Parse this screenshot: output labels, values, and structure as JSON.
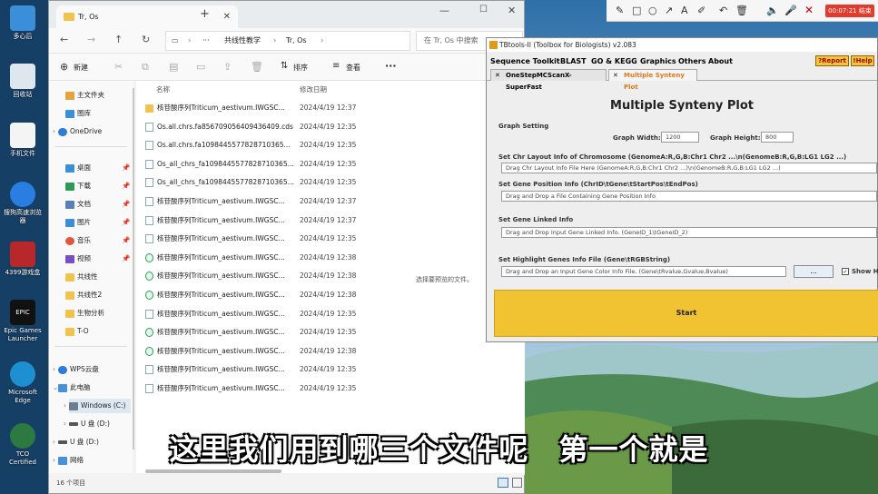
{
  "desktop": {
    "icons": [
      "多心后",
      "回收站",
      "手机文件",
      "搜狗高速浏览器",
      "4399游戏盒",
      "Epic Games Launcher",
      "Microsoft Edge",
      "TCO Certified"
    ]
  },
  "explorer": {
    "tab_title": "Tr, Os",
    "breadcrumb": [
      "共线性教学",
      "Tr, Os"
    ],
    "search_placeholder": "在 Tr, Os 中搜索",
    "toolbar": {
      "new": "新建",
      "sort": "排序",
      "view": "查看",
      "more": "···"
    },
    "sidebar": [
      "主文件夹",
      "图库",
      "OneDrive",
      "桌面",
      "下载",
      "文档",
      "图片",
      "音乐",
      "视频",
      "共线性",
      "共线性2",
      "生物分析",
      "T-O",
      "WPS云盘",
      "此电脑",
      "Windows (C:)",
      "U 盘 (D:)",
      "U 盘 (D:)",
      "网络"
    ],
    "columns": {
      "name": "名称",
      "date": "修改日期"
    },
    "files": [
      {
        "name": "核苷酸序列Triticum_aestivum.IWGSC...",
        "date": "2024/4/19 12:37",
        "kind": "folder"
      },
      {
        "name": "Os.all.chrs.fa85670905640943​6409.cds",
        "date": "2024/4/19 12:35",
        "kind": "file"
      },
      {
        "name": "Os.all.chrs.fa109844557782871​0365...",
        "date": "2024/4/19 12:35",
        "kind": "file"
      },
      {
        "name": "Os_all_chrs_fa109844557782871​0365...",
        "date": "2024/4/19 12:35",
        "kind": "file"
      },
      {
        "name": "Os_all_chrs_fa109844557782871​0365...",
        "date": "2024/4/19 12:35",
        "kind": "file"
      },
      {
        "name": "核苷酸序列Triticum_aestivum.IWGSC...",
        "date": "2024/4/19 12:37",
        "kind": "file"
      },
      {
        "name": "核苷酸序列Triticum_aestivum.IWGSC...",
        "date": "2024/4/19 12:37",
        "kind": "file"
      },
      {
        "name": "核苷酸序列Triticum_aestivum.IWGSC...",
        "date": "2024/4/19 12:35",
        "kind": "file"
      },
      {
        "name": "核苷酸序列Triticum_aestivum.IWGSC...",
        "date": "2024/4/19 12:38",
        "kind": "g"
      },
      {
        "name": "核苷酸序列Triticum_aestivum.IWGSC...",
        "date": "2024/4/19 12:38",
        "kind": "g"
      },
      {
        "name": "核苷酸序列Triticum_aestivum.IWGSC...",
        "date": "2024/4/19 12:38",
        "kind": "g"
      },
      {
        "name": "核苷酸序列Triticum_aestivum.IWGSC...",
        "date": "2024/4/19 12:35",
        "kind": "file"
      },
      {
        "name": "核苷酸序列Triticum_aestivum.IWGSC...",
        "date": "2024/4/19 12:35",
        "kind": "g"
      },
      {
        "name": "核苷酸序列Triticum_aestivum.IWGSC...",
        "date": "2024/4/19 12:38",
        "kind": "g"
      },
      {
        "name": "核苷酸序列Triticum_aestivum.IWGSC...",
        "date": "2024/4/19 12:35",
        "kind": "file"
      },
      {
        "name": "核苷酸序列Triticum_aestivum.IWGSC...",
        "date": "2024/4/19 12:35",
        "kind": "file"
      }
    ],
    "preview_hint": "选择要预览的文件。",
    "status": "16 个项目"
  },
  "tbtools": {
    "title": "TBtools-II (Toolbox for Biologists) v2.083",
    "menu": [
      "Sequence Toolkit",
      "BLAST",
      "GO & KEGG",
      "Graphics",
      "Others",
      "About"
    ],
    "report": "?Report",
    "help": "!Help",
    "tabs": [
      "OneStepMCScanX-SuperFast",
      "Multiple Synteny Plot"
    ],
    "heading": "Multiple Synteny Plot",
    "graph_setting": "Graph Setting",
    "graph_width_label": "Graph Width:",
    "graph_width": "1200",
    "graph_height_label": "Graph Height:",
    "graph_height": "800",
    "chr_layout_label": "Set Chr Layout Info of Chromosome (GenomeA:R,G,B:Chr1 Chr2 ...\\n(GenomeB:R,G,B:LG1 LG2 ...)",
    "chr_layout_hint": "Drag Chr Layout Info File Here (GenomeA:R,G,B:Chr1 Chr2 ...)\\n(GenomeB:R,G,B:LG1 LG2 ...)",
    "gene_pos_label": "Set Gene Position Info (ChrID\\tGene\\tStartPos\\tEndPos)",
    "gene_pos_hint": "Drag and Drop a File Containing Gene Position Info",
    "linked_label": "Set Gene Linked Info",
    "linked_hint": "Drag and Drop Input Gene Linked Info. (GeneID_1\\tGeneID_2)",
    "highlight_label": "Set Highlight Genes Info File (Gene\\tRGBString)",
    "highlight_hint": "Drag and Drop an Input Gene Color Info File. (Gene\\tRvalue,Gvalue,Bvalue)",
    "browse": "...",
    "show_label": "Show Hi",
    "start": "Start"
  },
  "recorder": {
    "timer": "00:07:21 结束"
  },
  "subtitle": "这里我们用到哪三个文件呢　第一个就是"
}
